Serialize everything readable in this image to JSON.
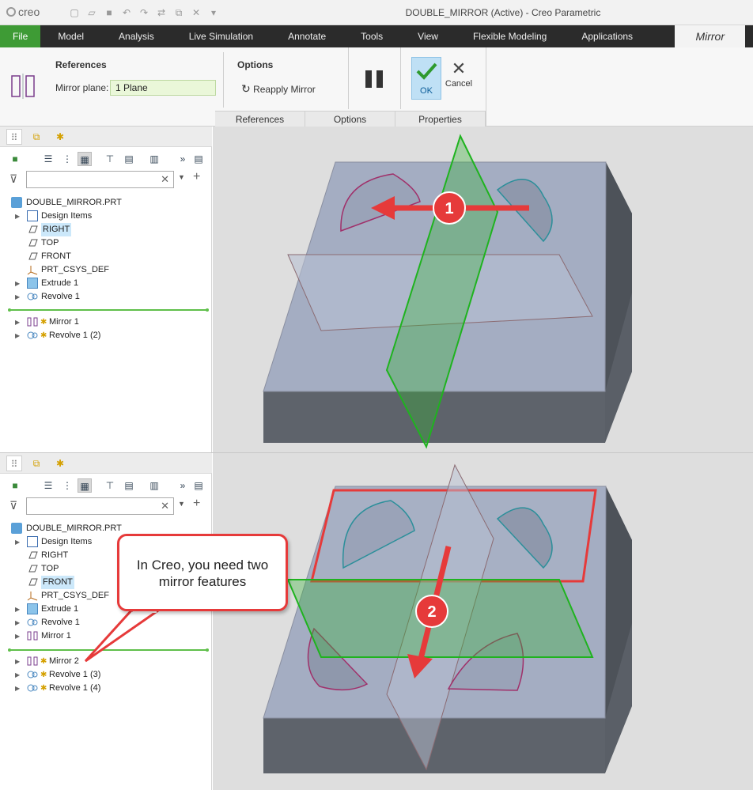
{
  "app": {
    "logo": "creo",
    "title": "DOUBLE_MIRROR (Active) - Creo Parametric"
  },
  "ribbon": {
    "tabs": [
      "File",
      "Model",
      "Analysis",
      "Live Simulation",
      "Annotate",
      "Tools",
      "View",
      "Flexible Modeling",
      "Applications"
    ],
    "active_tab": "Mirror"
  },
  "dashboard": {
    "references_title": "References",
    "mirror_plane_label": "Mirror plane:",
    "mirror_plane_value": "1 Plane",
    "options_title": "Options",
    "reapply_label": "Reapply Mirror",
    "ok_label": "OK",
    "cancel_label": "Cancel",
    "subtabs": [
      "References",
      "Options",
      "Properties"
    ]
  },
  "tree_top": {
    "root": "DOUBLE_MIRROR.PRT",
    "items": [
      "Design Items",
      "RIGHT",
      "TOP",
      "FRONT",
      "PRT_CSYS_DEF",
      "Extrude 1",
      "Revolve 1"
    ],
    "after_insert": [
      "Mirror 1",
      "Revolve 1 (2)"
    ],
    "highlight": "RIGHT"
  },
  "tree_bottom": {
    "root": "DOUBLE_MIRROR.PRT",
    "items": [
      "Design Items",
      "RIGHT",
      "TOP",
      "FRONT",
      "PRT_CSYS_DEF",
      "Extrude 1",
      "Revolve 1",
      "Mirror 1"
    ],
    "after_insert": [
      "Mirror 2",
      "Revolve 1 (3)",
      "Revolve 1 (4)"
    ],
    "highlight": "FRONT"
  },
  "annotations": {
    "step1": "1",
    "step2": "2",
    "callout": "In Creo, you need two mirror features"
  },
  "colors": {
    "file_tab": "#3e9b35",
    "plane_field": "#eaf7d9",
    "arrow": "#e63a3a",
    "mirror_plane": "#1fb31f",
    "block_top": "#a4adc2",
    "block_side": "#565b63"
  }
}
